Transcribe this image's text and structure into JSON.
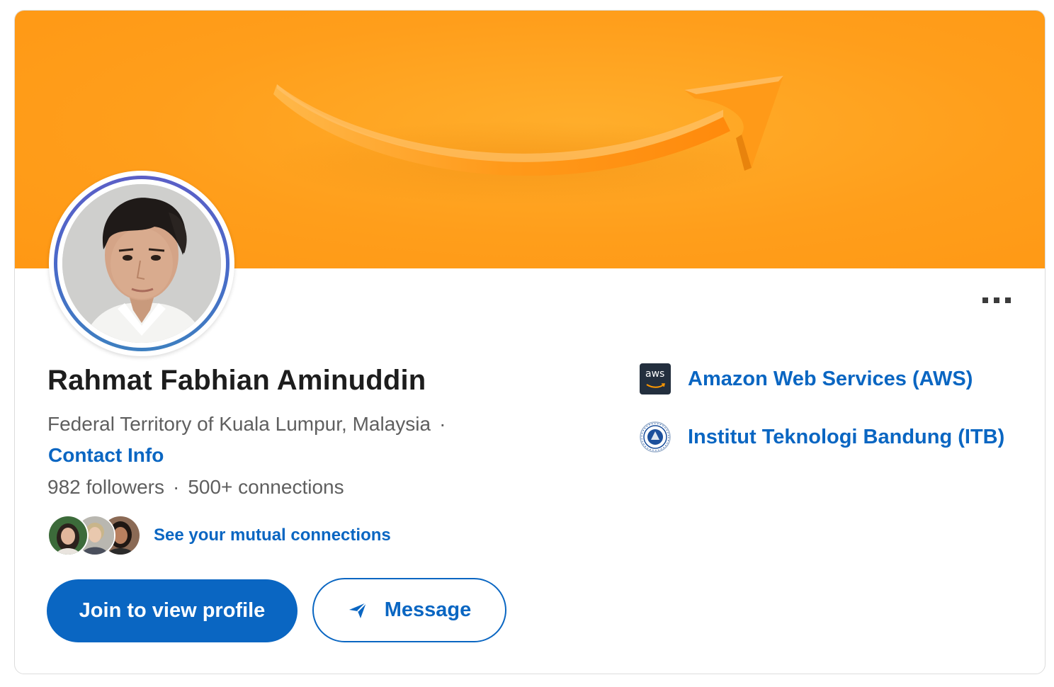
{
  "profile": {
    "name": "Rahmat Fabhian Aminuddin",
    "location": "Federal Territory of Kuala Lumpur, Malaysia",
    "location_separator": "·",
    "contact_info": "Contact Info",
    "followers": "982 followers",
    "stats_separator": "·",
    "connections": "500+ connections",
    "mutual_connections_link": "See your mutual connections"
  },
  "actions": {
    "join_label": "Join to view profile",
    "message_label": "Message"
  },
  "experience": [
    {
      "name": "Amazon Web Services (AWS)",
      "logo_text": "aws",
      "logo_icon": "aws-logo-icon"
    },
    {
      "name": "Institut Teknologi Bandung (ITB)",
      "logo_icon": "itb-seal-icon"
    }
  ],
  "colors": {
    "brand_blue": "#0a66c2",
    "banner_orange": "#ff9e1b",
    "aws_navy": "#232f3e"
  },
  "icons": {
    "more": "more-horizontal-icon",
    "send": "send-icon"
  }
}
